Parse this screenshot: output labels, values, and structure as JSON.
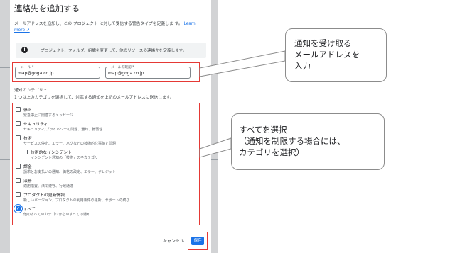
{
  "dialog": {
    "title": "連絡先を追加する",
    "description": "メールアドレスを追加し、この プロジェクト に対して受信する警告タイプを定義しま す。",
    "learn_more": "Learn more ↗",
    "info_text": "プロジェクト、フォルダ、組織を変更して、他のリソースの連絡先を定義します。"
  },
  "email": {
    "label": "メール *",
    "value": "map@goga.co.jp",
    "confirm_label": "メールの確認 *",
    "confirm_value": "map@goga.co.jp"
  },
  "categories": {
    "title": "通知のカテゴリ *",
    "description": "1 つ以上のカテゴリを選択して、対応する通知を上記のメールアドレスに送信します。",
    "items": [
      {
        "label": "停止",
        "sub": "緊急停止に関連するメッセージ",
        "checked": false
      },
      {
        "label": "セキュリティ",
        "sub": "セキュリティ/プライバシーの問題、通知、脆弱性",
        "checked": false
      },
      {
        "label": "技術",
        "sub": "サービスの停止、エラー、バグなどの技術的な事象と問題",
        "checked": false
      },
      {
        "label": "技術的なインシデント",
        "sub": "インシデント通知の「技術」の子カテゴリ",
        "checked": false
      },
      {
        "label": "課金",
        "sub": "請求とお支払いの通知、価格の改定、エラー、クレジット",
        "checked": false
      },
      {
        "label": "法務",
        "sub": "適用措置、法令遵守、行政通達",
        "checked": false
      },
      {
        "label": "プロダクトの更新情報",
        "sub": "新しいバージョン、プロダクトの利用条件の更新、サポートの終了",
        "checked": false
      },
      {
        "label": "すべて",
        "sub": "他のすべてのカテゴリからのすべての通知",
        "checked": true
      }
    ]
  },
  "actions": {
    "cancel": "キャンセル",
    "save": "保存"
  },
  "callouts": {
    "email": [
      "通知を受け取る",
      "メールアドレスを",
      "入力"
    ],
    "categories": [
      "すべてを選択",
      "（通知を制限する場合には、",
      "カテゴリを選択）"
    ]
  },
  "colors": {
    "accent": "#1a73e8",
    "highlight": "#e53935",
    "backdrop": "#d2d3d5"
  }
}
